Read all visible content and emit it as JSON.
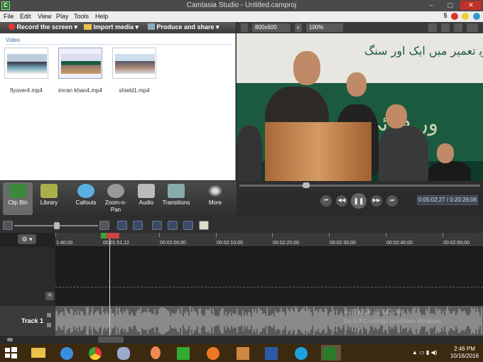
{
  "window": {
    "title": "Camtasia Studio - Untitled.camproj",
    "min": "–",
    "max": "▢",
    "close": "✕"
  },
  "menu": {
    "items": [
      "File",
      "Edit",
      "View",
      "Play",
      "Tools",
      "Help"
    ],
    "notifications": "5"
  },
  "toolbar": {
    "record": "Record the screen",
    "import": "Import media",
    "produce": "Produce and share"
  },
  "clipbin": {
    "section": "Video",
    "clips": [
      {
        "label": "flyover4.mp4"
      },
      {
        "label": "imran khan4.mp4"
      },
      {
        "label": "shield1.mp4"
      }
    ]
  },
  "preview": {
    "dimensions": "800x600",
    "zoom": "100%",
    "playback_position": 0.27
  },
  "player": {
    "time": "0:05:02;27 / 0:20:26;06",
    "prev": "⏮",
    "rewind": "◀◀",
    "pause": "❚❚",
    "forward": "▶▶",
    "next": "⏭"
  },
  "tasks": [
    {
      "label": "Clip Bin"
    },
    {
      "label": "Library"
    },
    {
      "label": "Callouts"
    },
    {
      "label": "Zoom-n-\nPan"
    },
    {
      "label": "Audio"
    },
    {
      "label": "Transitions"
    },
    {
      "label": "More"
    }
  ],
  "timeline": {
    "ticks": [
      "1:40;00",
      "00:01:51;12",
      "00:02:00;00",
      "00:02:10;00",
      "00:02:20;00",
      "00:02:30;00",
      "00:02:40;00",
      "00:02:50;00"
    ],
    "playhead_label": "00:01:51;12",
    "add_track": "+",
    "track_name": "Track 1",
    "settings": "⚙ ▾"
  },
  "watermark": {
    "line1": "Activate Windows",
    "line2": "Go to PC settings to activate Windows."
  },
  "taskbar": {
    "time": "2:46 PM",
    "date": "10/16/2016"
  },
  "colors": {
    "title_bg": "#4a4a4a",
    "close": "#c03028",
    "taskbar": "#3c2a10",
    "banner_green": "#1b5a3e"
  }
}
